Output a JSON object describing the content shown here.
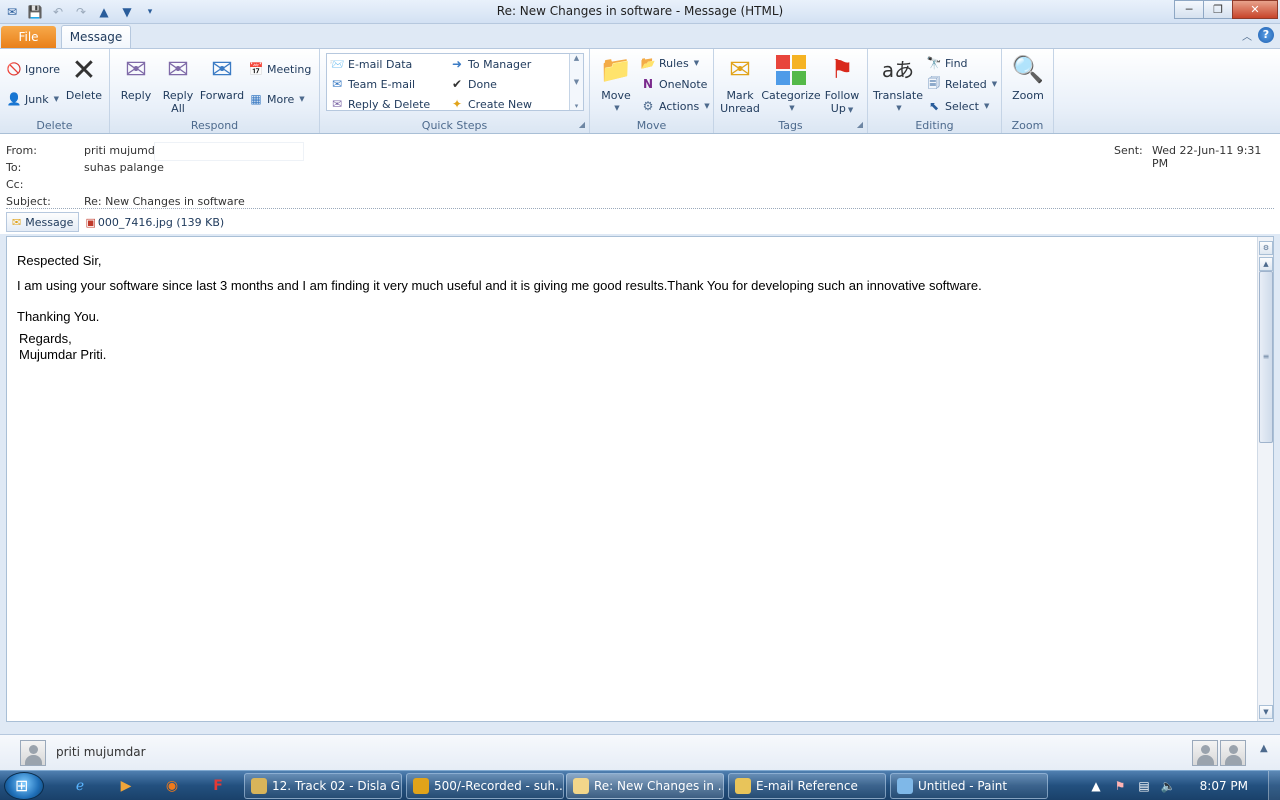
{
  "window": {
    "title": "Re: New Changes in software  -  Message (HTML)"
  },
  "tabs": {
    "file": "File",
    "message": "Message"
  },
  "ribbon": {
    "delete_group": {
      "label": "Delete",
      "ignore": "Ignore",
      "junk": "Junk",
      "delete": "Delete"
    },
    "respond_group": {
      "label": "Respond",
      "reply": "Reply",
      "reply_all_1": "Reply",
      "reply_all_2": "All",
      "forward": "Forward",
      "meeting": "Meeting",
      "more": "More"
    },
    "quicksteps_group": {
      "label": "Quick Steps",
      "items": [
        "E-mail Data",
        "To Manager",
        "Team E-mail",
        "Done",
        "Reply & Delete",
        "Create New"
      ]
    },
    "move_group": {
      "label": "Move",
      "move": "Move",
      "rules": "Rules",
      "onenote": "OneNote",
      "actions": "Actions"
    },
    "tags_group": {
      "label": "Tags",
      "mark_unread_1": "Mark",
      "mark_unread_2": "Unread",
      "categorize": "Categorize",
      "follow_up_1": "Follow",
      "follow_up_2": "Up"
    },
    "editing_group": {
      "label": "Editing",
      "translate": "Translate",
      "find": "Find",
      "related": "Related",
      "select": "Select"
    },
    "zoom_group": {
      "label": "Zoom",
      "zoom": "Zoom"
    }
  },
  "header": {
    "from_label": "From:",
    "from_value": "priti mujumdar",
    "to_label": "To:",
    "to_value": "suhas palange",
    "cc_label": "Cc:",
    "subject_label": "Subject:",
    "subject_value": "Re: New Changes in software",
    "sent_label": "Sent:",
    "sent_value": "Wed 22-Jun-11 9:31 PM",
    "message_tab": "Message",
    "attachment": "000_7416.jpg (139 KB)"
  },
  "body": {
    "greeting": "Respected Sir,",
    "line1": "I am using your software since last 3 months and I am finding it very much useful and it is giving me good results.Thank You for developing such an innovative software.",
    "thanks": "Thanking You.",
    "regards": "Regards,",
    "signature": "Mujumdar Priti."
  },
  "people_pane": {
    "name": "priti mujumdar"
  },
  "taskbar": {
    "items": [
      "12. Track 02 - Disla G...",
      "500/-Recorded - suh...",
      "Re: New Changes in ...",
      "E-mail Reference",
      "Untitled - Paint"
    ],
    "clock": "8:07 PM"
  }
}
